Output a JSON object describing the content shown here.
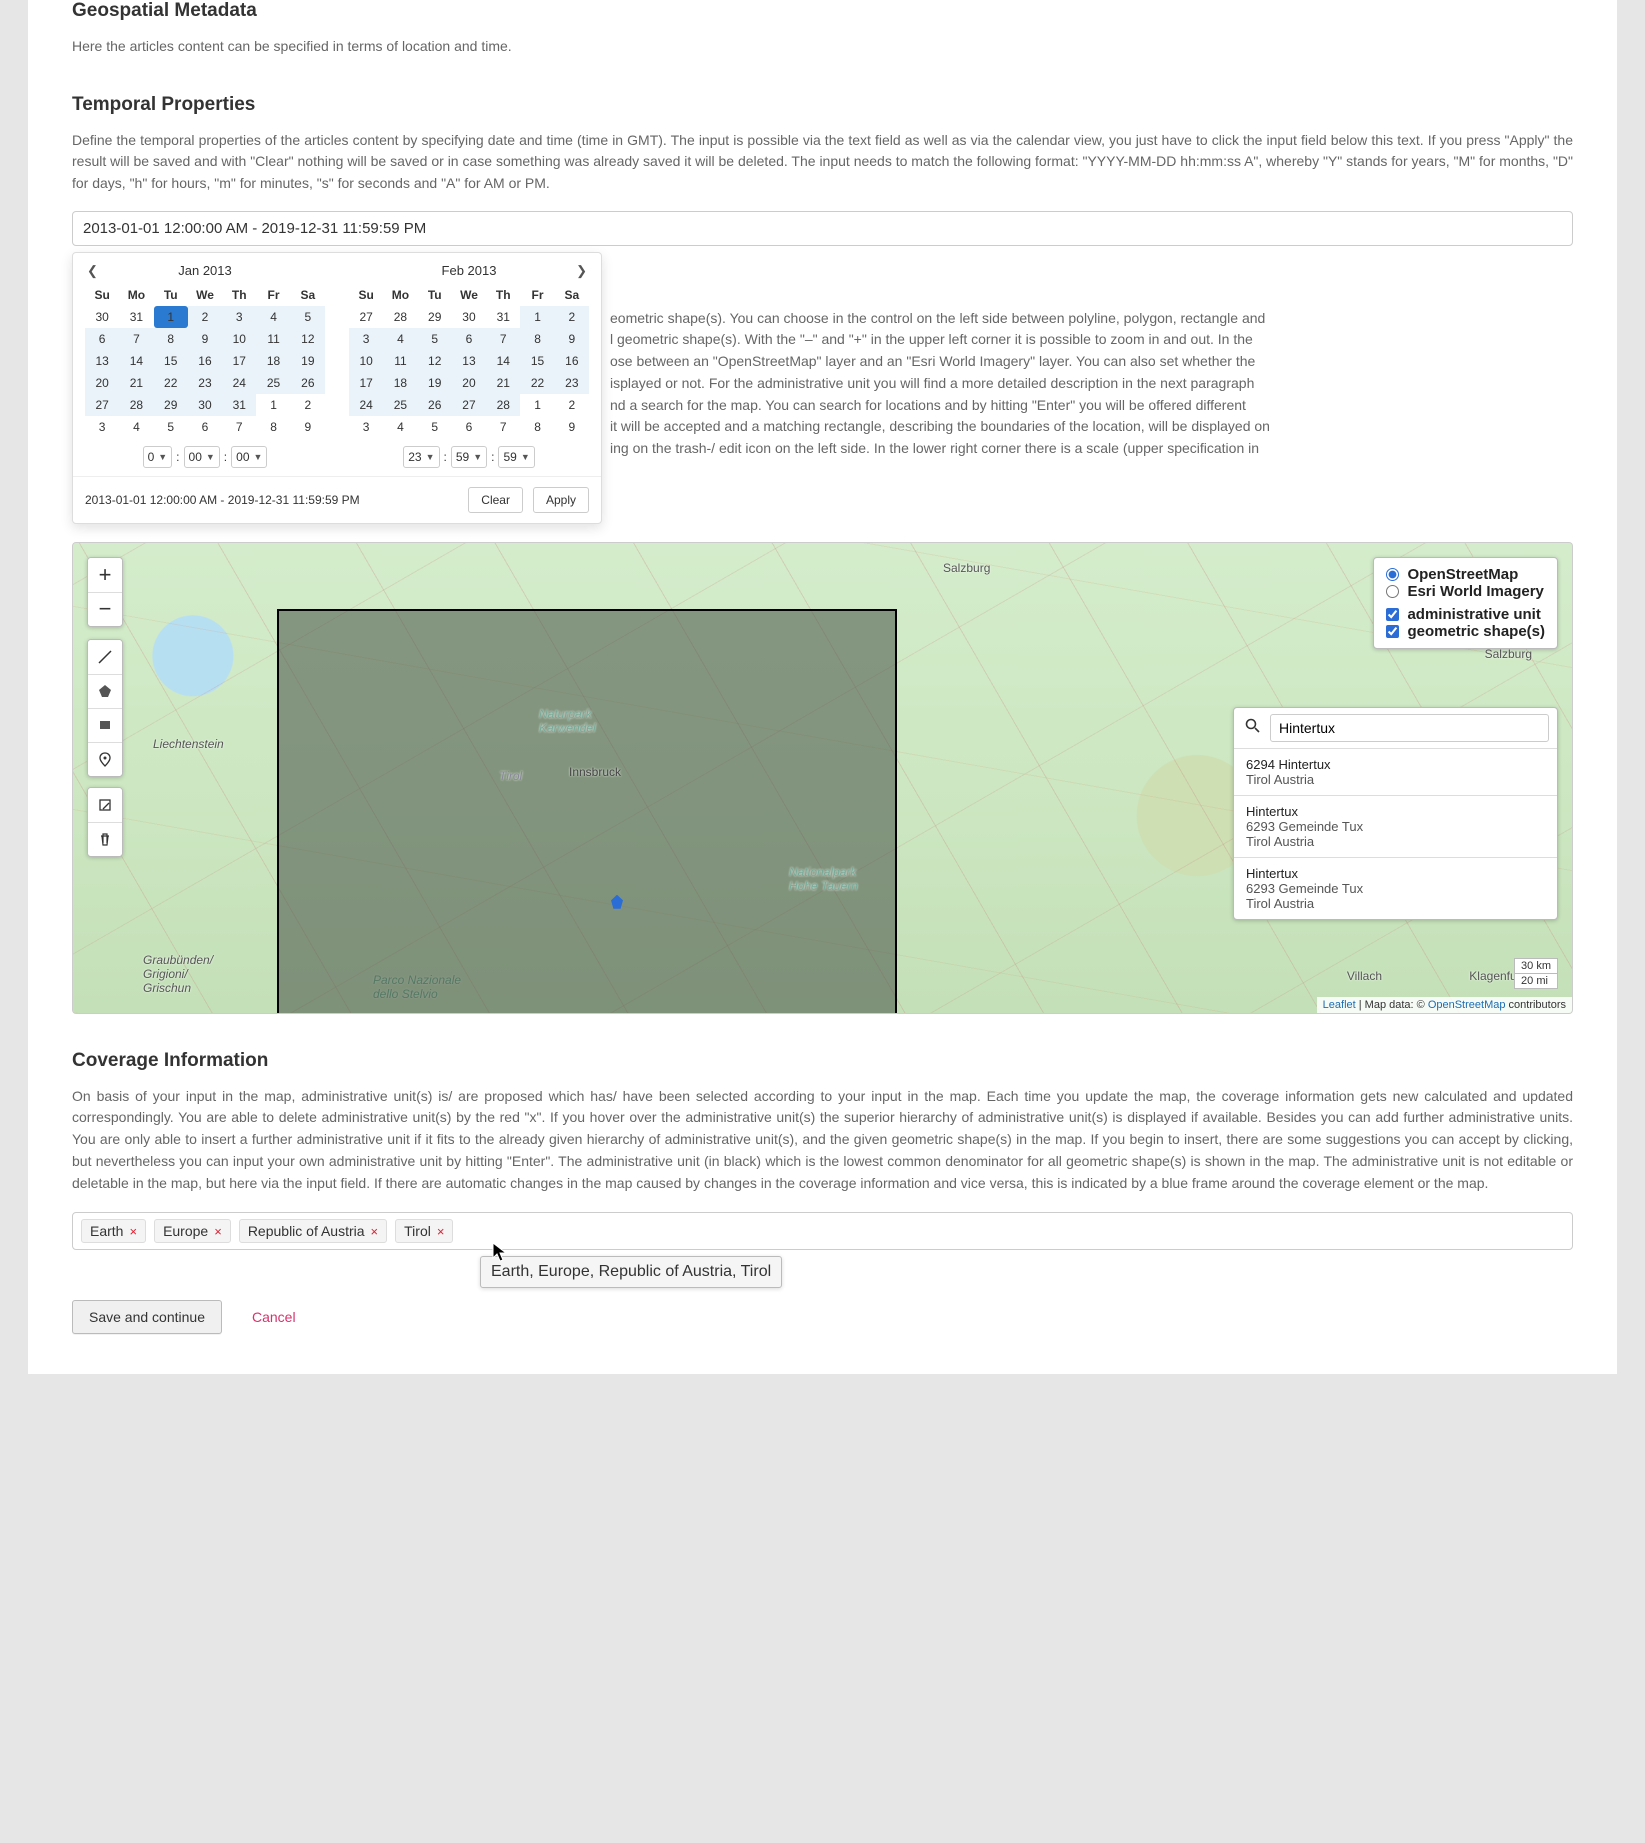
{
  "sections": {
    "geo_title": "Geospatial Metadata",
    "geo_desc": "Here the articles content can be specified in terms of location and time.",
    "temp_title": "Temporal Properties",
    "temp_desc": "Define the temporal properties of the articles content by specifying date and time (time in GMT). The input is possible via the text field as well as via the calendar view, you just have to click the input field below this text. If you press \"Apply\" the result will be saved and with \"Clear\" nothing will be saved or in case something was already saved it will be deleted. The input needs to match the following format: \"YYYY-MM-DD hh:mm:ss A\", whereby \"Y\" stands for years, \"M\" for months, \"D\" for days, \"h\" for hours, \"m\" for minutes, \"s\" for seconds and \"A\" for AM or PM.",
    "spatial_desc_fragment1": "eometric shape(s). You can choose in the control on the left side between polyline, polygon, rectangle and",
    "spatial_desc_fragment2": "l geometric shape(s). With the \"–\" and \"+\" in the upper left corner it is possible to zoom in and out. In the",
    "spatial_desc_fragment3": "ose between an \"OpenStreetMap\" layer and an \"Esri World Imagery\" layer. You can also set whether the",
    "spatial_desc_fragment4": "isplayed or not. For the administrative unit you will find a more detailed description in the next paragraph",
    "spatial_desc_fragment5": "nd a search for the map. You can search for locations and by hitting \"Enter\" you will be offered different",
    "spatial_desc_fragment6": "it will be accepted and a matching rectangle, describing the boundaries of the location, will be displayed on",
    "spatial_desc_fragment7": "ing on the trash-/ edit icon on the left side. In the lower right corner there is a scale (upper specification in",
    "cov_title": "Coverage Information",
    "cov_desc": "On basis of your input in the map, administrative unit(s) is/ are proposed which has/ have been selected according to your input in the map. Each time you update the map, the coverage information gets new calculated and updated correspondingly. You are able to delete administrative unit(s) by the red \"x\". If you hover over the administrative unit(s) the superior hierarchy of administrative unit(s) is displayed if available. Besides you can add further administrative units. You are only able to insert a further administrative unit if it fits to the already given hierarchy of administrative unit(s), and the given geometric shape(s) in the map. If you begin to insert, there are some suggestions you can accept by clicking, but nevertheless you can input your own administrative unit by hitting \"Enter\". The administrative unit (in black) which is the lowest common denominator for all geometric shape(s) is shown in the map. The administrative unit is not editable or deletable in the map, but here via the input field. If there are automatic changes in the map caused by changes in the coverage information and vice versa, this is indicated by a blue frame around the coverage element or the map."
  },
  "daterange": {
    "value": "2013-01-01 12:00:00 AM - 2019-12-31 11:59:59 PM",
    "month1_title": "Jan 2013",
    "month2_title": "Feb 2013",
    "dow": [
      "Su",
      "Mo",
      "Tu",
      "We",
      "Th",
      "Fr",
      "Sa"
    ],
    "month1": [
      [
        {
          "n": "30",
          "off": true
        },
        {
          "n": "31",
          "off": true
        },
        {
          "n": "1",
          "start": true
        },
        {
          "n": "2",
          "r": true
        },
        {
          "n": "3",
          "r": true
        },
        {
          "n": "4",
          "r": true
        },
        {
          "n": "5",
          "r": true
        }
      ],
      [
        {
          "n": "6",
          "r": true
        },
        {
          "n": "7",
          "r": true
        },
        {
          "n": "8",
          "r": true
        },
        {
          "n": "9",
          "r": true
        },
        {
          "n": "10",
          "r": true
        },
        {
          "n": "11",
          "r": true
        },
        {
          "n": "12",
          "r": true
        }
      ],
      [
        {
          "n": "13",
          "r": true
        },
        {
          "n": "14",
          "r": true
        },
        {
          "n": "15",
          "r": true
        },
        {
          "n": "16",
          "r": true
        },
        {
          "n": "17",
          "r": true
        },
        {
          "n": "18",
          "r": true
        },
        {
          "n": "19",
          "r": true
        }
      ],
      [
        {
          "n": "20",
          "r": true
        },
        {
          "n": "21",
          "r": true
        },
        {
          "n": "22",
          "r": true
        },
        {
          "n": "23",
          "r": true
        },
        {
          "n": "24",
          "r": true
        },
        {
          "n": "25",
          "r": true
        },
        {
          "n": "26",
          "r": true
        }
      ],
      [
        {
          "n": "27",
          "r": true
        },
        {
          "n": "28",
          "r": true
        },
        {
          "n": "29",
          "r": true
        },
        {
          "n": "30",
          "r": true
        },
        {
          "n": "31",
          "r": true
        },
        {
          "n": "1",
          "off": true
        },
        {
          "n": "2",
          "off": true
        }
      ],
      [
        {
          "n": "3",
          "off": true
        },
        {
          "n": "4",
          "off": true
        },
        {
          "n": "5",
          "off": true
        },
        {
          "n": "6",
          "off": true
        },
        {
          "n": "7",
          "off": true
        },
        {
          "n": "8",
          "off": true
        },
        {
          "n": "9",
          "off": true
        }
      ]
    ],
    "month2": [
      [
        {
          "n": "27",
          "off": true
        },
        {
          "n": "28",
          "off": true
        },
        {
          "n": "29",
          "off": true
        },
        {
          "n": "30",
          "off": true
        },
        {
          "n": "31",
          "off": true
        },
        {
          "n": "1",
          "r": true
        },
        {
          "n": "2",
          "r": true
        }
      ],
      [
        {
          "n": "3",
          "r": true
        },
        {
          "n": "4",
          "r": true
        },
        {
          "n": "5",
          "r": true
        },
        {
          "n": "6",
          "r": true
        },
        {
          "n": "7",
          "r": true
        },
        {
          "n": "8",
          "r": true
        },
        {
          "n": "9",
          "r": true
        }
      ],
      [
        {
          "n": "10",
          "r": true
        },
        {
          "n": "11",
          "r": true
        },
        {
          "n": "12",
          "r": true
        },
        {
          "n": "13",
          "r": true
        },
        {
          "n": "14",
          "r": true
        },
        {
          "n": "15",
          "r": true
        },
        {
          "n": "16",
          "r": true
        }
      ],
      [
        {
          "n": "17",
          "r": true
        },
        {
          "n": "18",
          "r": true
        },
        {
          "n": "19",
          "r": true
        },
        {
          "n": "20",
          "r": true
        },
        {
          "n": "21",
          "r": true
        },
        {
          "n": "22",
          "r": true
        },
        {
          "n": "23",
          "r": true
        }
      ],
      [
        {
          "n": "24",
          "r": true
        },
        {
          "n": "25",
          "r": true
        },
        {
          "n": "26",
          "r": true
        },
        {
          "n": "27",
          "r": true
        },
        {
          "n": "28",
          "r": true
        },
        {
          "n": "1",
          "off": true
        },
        {
          "n": "2",
          "off": true
        }
      ],
      [
        {
          "n": "3",
          "off": true
        },
        {
          "n": "4",
          "off": true
        },
        {
          "n": "5",
          "off": true
        },
        {
          "n": "6",
          "off": true
        },
        {
          "n": "7",
          "off": true
        },
        {
          "n": "8",
          "off": true
        },
        {
          "n": "9",
          "off": true
        }
      ]
    ],
    "time1": {
      "h": "0",
      "m": "00",
      "s": "00"
    },
    "time2": {
      "h": "23",
      "m": "59",
      "s": "59"
    },
    "summary": "2013-01-01 12:00:00 AM - 2019-12-31 11:59:59 PM",
    "clear": "Clear",
    "apply": "Apply"
  },
  "map": {
    "labels": {
      "salzburg1": "Salzburg",
      "salzburg2": "Salzburg",
      "liecht": "Liechtenstein",
      "graub": "Graubünden/\nGrigioni/\nGrischun",
      "parco": "Parco Nazionale\ndello Stelvio",
      "naturpark": "Naturpark\nKarwendel",
      "tirol": "Tirol",
      "innsbruck": "Innsbruck",
      "hohe": "Nationalpark\nHohe Tauern",
      "villach": "Villach",
      "klagen": "Klagenfurt"
    },
    "layers": {
      "osm": "OpenStreetMap",
      "esri": "Esri World Imagery",
      "admin": "administrative unit",
      "geom": "geometric shape(s)"
    },
    "search_value": "Hintertux",
    "results": [
      {
        "line1": "6294 Hintertux",
        "line2": "Tirol Austria"
      },
      {
        "line1": "Hintertux",
        "line2": "6293 Gemeinde Tux",
        "line3": "Tirol Austria"
      },
      {
        "line1": "Hintertux",
        "line2": "6293 Gemeinde Tux",
        "line3": "Tirol Austria"
      }
    ],
    "scale": {
      "km": "30 km",
      "mi": "20 mi"
    },
    "attr": {
      "leaflet": "Leaflet",
      "sep": " | Map data: © ",
      "osm": "OpenStreetMap",
      "tail": " contributors"
    },
    "icons": {
      "plus": "+",
      "minus": "−"
    }
  },
  "coverage": {
    "tags": [
      "Earth",
      "Europe",
      "Republic of Austria",
      "Tirol"
    ],
    "tooltip": "Earth, Europe, Republic of Austria, Tirol",
    "remove": "×"
  },
  "buttons": {
    "save": "Save and continue",
    "cancel": "Cancel"
  }
}
